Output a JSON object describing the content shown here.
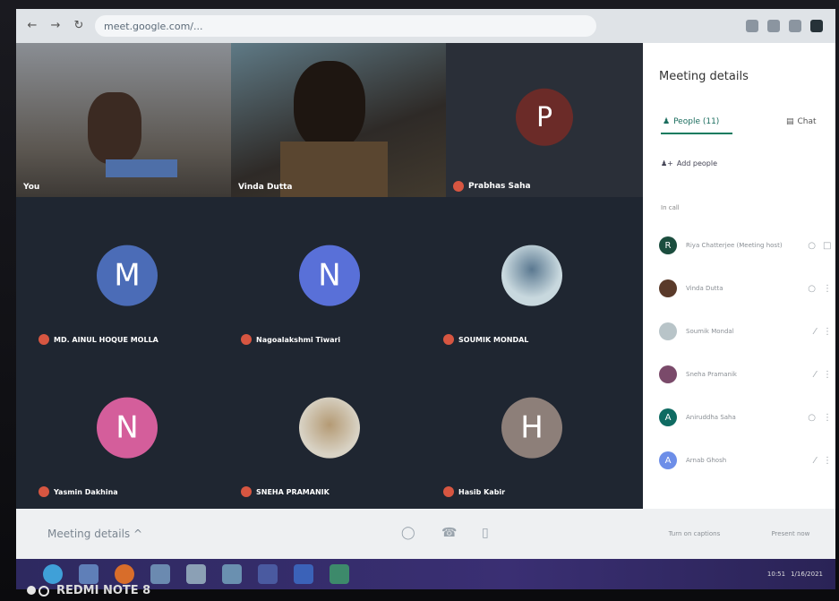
{
  "browser": {
    "url": "meet.google.com/..."
  },
  "top_tiles": [
    {
      "name": "You"
    },
    {
      "name": "Vinda Dutta"
    },
    {
      "name": "Prabhas Saha"
    }
  ],
  "top_tile_avatar": {
    "letter": "P",
    "color": "#6b2b28"
  },
  "grid": [
    {
      "name": "MD. AINUL HOQUE MOLLA",
      "letter": "M",
      "color": "#4b6cb7"
    },
    {
      "name": "Nagoalakshmi Tiwari",
      "letter": "N",
      "color": "#5970d8"
    },
    {
      "name": "SOUMIK MONDAL",
      "letter": "",
      "color": "#c8d8de"
    },
    {
      "name": "Yasmin Dakhina",
      "letter": "N",
      "color": "#d45e9b"
    },
    {
      "name": "SNEHA PRAMANIK",
      "letter": "",
      "color": "#d8d2c4"
    },
    {
      "name": "Hasib Kabir",
      "letter": "H",
      "color": "#8d7f79"
    }
  ],
  "bottom_bar": {
    "meeting_details": "Meeting details ^"
  },
  "panel": {
    "title": "Meeting details",
    "tab_people": "People (11)",
    "tab_chat": "Chat",
    "add_people": "Add people",
    "section_label": "In call",
    "people": [
      {
        "name": "Riya Chatterjee (Meeting host)",
        "letter": "R",
        "color": "#1b4d3e"
      },
      {
        "name": "Vinda Dutta",
        "letter": "",
        "color": "#5a3a2a"
      },
      {
        "name": "Soumik Mondal",
        "letter": "",
        "color": "#b8c4c8"
      },
      {
        "name": "Sneha Pramanik",
        "letter": "",
        "color": "#7a4a6a"
      },
      {
        "name": "Aniruddha Saha",
        "letter": "A",
        "color": "#0f6b62"
      },
      {
        "name": "Arnab Ghosh",
        "letter": "A",
        "color": "#6d8ee8"
      }
    ],
    "bottom_left": "Turn on captions",
    "bottom_right": "Present now"
  },
  "taskbar": {
    "clock": "10:51",
    "date": "1/16/2021"
  },
  "watermark": "REDMI NOTE 8",
  "colors": {
    "meet_bg": "#1f2631",
    "taskbar": "#2e2960",
    "accent_green": "#0f7b5f"
  }
}
